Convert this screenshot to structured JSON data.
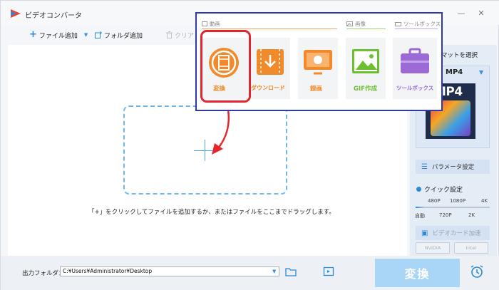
{
  "window": {
    "title": "ビデオコンバータ",
    "minimize_icon": "minimize-icon",
    "close_label": "✕"
  },
  "toolbar": {
    "add_file": "ファイル追加",
    "add_folder": "フォルダ追加",
    "clear": "クリア"
  },
  "popup": {
    "sections": {
      "video": "動画",
      "image": "画像",
      "toolbox": "ツールボックス"
    },
    "tiles": [
      {
        "label": "変換",
        "icon": "film-reel-icon",
        "color": "#f08a2a"
      },
      {
        "label": "ダウンロード",
        "icon": "download-icon",
        "color": "#f08a2a"
      },
      {
        "label": "録画",
        "icon": "screen-record-icon",
        "color": "#f08a2a"
      },
      {
        "label": "GIF作成",
        "icon": "image-icon",
        "color": "#6cbf2e"
      },
      {
        "label": "ツールボックス",
        "icon": "toolbox-icon",
        "color": "#9b6ad6"
      }
    ]
  },
  "main": {
    "hint": "「+」をクリックしてファイルを追加するか、またはファイルをここまでドラッグします。"
  },
  "right_panel": {
    "format_label": "マットを選択",
    "format_name": "MP4",
    "cover_text": "MP4",
    "params_button": "パラメータ設定",
    "quick_label": "クイック設定",
    "quick_top": [
      "480P",
      "1080P",
      "4K"
    ],
    "quick_bottom": [
      "自動",
      "720P",
      "2K"
    ],
    "gpu_label": "ビデオカード加速",
    "gpu_chips": [
      "NVIDIA",
      "Intel"
    ]
  },
  "bottom": {
    "output_label": "出力フォルダ：",
    "output_path": "C:¥Users¥Administrator¥Desktop",
    "convert_button": "変換"
  },
  "colors": {
    "accent": "#2a8ad8",
    "orange": "#f08a2a",
    "green": "#6cbf2e",
    "purple": "#9b6ad6",
    "highlight_red": "#e3262e",
    "popup_border": "#2e3aa8"
  }
}
